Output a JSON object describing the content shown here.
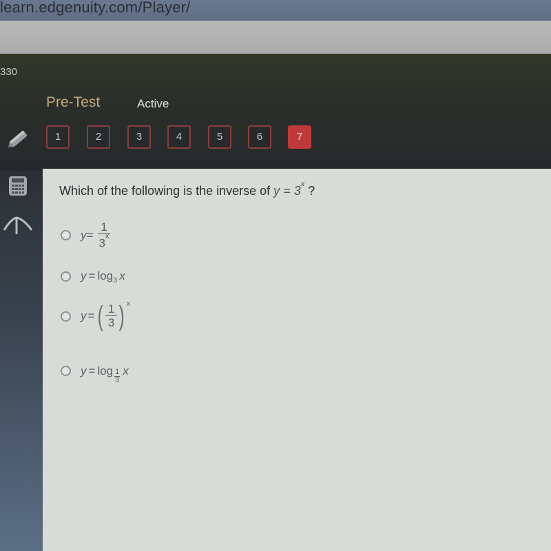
{
  "browser": {
    "url": "learn.edgenuity.com/Player/"
  },
  "header": {
    "counter": "330",
    "activity_type": "Pre-Test",
    "status": "Active"
  },
  "question_nav": {
    "items": [
      {
        "label": "1",
        "state": "answered"
      },
      {
        "label": "2",
        "state": "answered"
      },
      {
        "label": "3",
        "state": "answered"
      },
      {
        "label": "4",
        "state": "answered"
      },
      {
        "label": "5",
        "state": "answered"
      },
      {
        "label": "6",
        "state": "answered"
      },
      {
        "label": "7",
        "state": "current"
      }
    ],
    "current_color": "#c0393a",
    "border_color": "#8b3d3d"
  },
  "tools": [
    {
      "icon": "pencil-icon"
    },
    {
      "icon": "calculator-icon"
    },
    {
      "icon": "reference-icon"
    }
  ],
  "question": {
    "prompt": "Which of the following is the inverse of",
    "prompt_math": {
      "lhs": "y",
      "eq": "=",
      "base": "3",
      "exp": "x"
    },
    "prompt_end": "?",
    "options": [
      {
        "lhs": "y",
        "eq": "=",
        "numerator": "1",
        "denominator_base": "3",
        "denominator_exp": "x"
      },
      {
        "lhs": "y",
        "eq": "=",
        "func": "log",
        "base": "3",
        "arg": "x"
      },
      {
        "lhs": "y",
        "eq": "=",
        "numerator": "1",
        "denominator": "3",
        "exp": "x"
      },
      {
        "lhs": "y",
        "eq": "=",
        "func": "log",
        "base_num": "1",
        "base_den": "3",
        "arg": "x"
      }
    ]
  }
}
